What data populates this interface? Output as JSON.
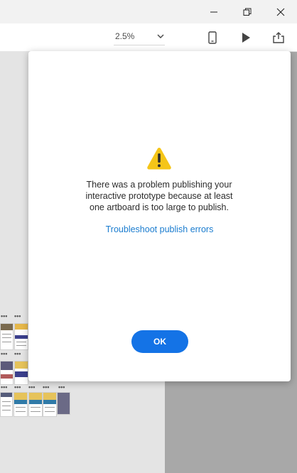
{
  "window": {
    "minimize_icon": "minimize-icon",
    "restore_icon": "restore-icon",
    "close_icon": "close-icon"
  },
  "toolbar": {
    "zoom_value": "2.5%",
    "device_icon": "mobile-device-icon",
    "play_icon": "play-icon",
    "share_icon": "share-icon"
  },
  "canvas": {
    "more_indicator": "•••"
  },
  "dialog": {
    "warning_icon": "warning-icon",
    "message": "There was a problem publishing your interactive prototype because at least one artboard is too large to publish.",
    "link": "Troubleshoot publish errors",
    "ok_label": "OK",
    "accent_color": "#1473e6",
    "warning_color": "#f5c518"
  }
}
